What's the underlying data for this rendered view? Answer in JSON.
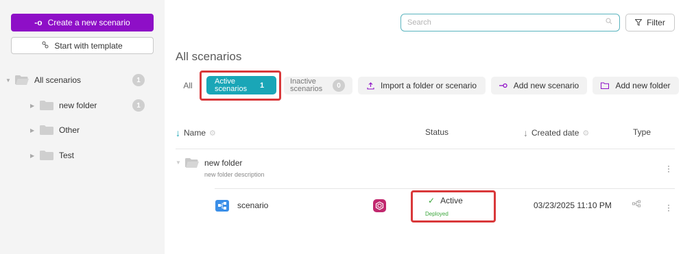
{
  "sidebar": {
    "create_label": "Create a new scenario",
    "template_label": "Start with template",
    "tree": [
      {
        "label": "All scenarios",
        "count": "1"
      },
      {
        "label": "new folder",
        "count": "1"
      },
      {
        "label": "Other"
      },
      {
        "label": "Test"
      }
    ]
  },
  "header": {
    "search_placeholder": "Search",
    "filter_label": "Filter",
    "title": "All scenarios"
  },
  "tabs": {
    "all": "All",
    "active_label": "Active scenarios",
    "active_count": "1",
    "inactive_label": "Inactive scenarios",
    "inactive_count": "0"
  },
  "actions": {
    "import": "Import a folder or scenario",
    "add_scenario": "Add new scenario",
    "add_folder": "Add new folder"
  },
  "table": {
    "columns": {
      "name": "Name",
      "status": "Status",
      "created": "Created date",
      "type": "Type"
    },
    "folder": {
      "name": "new folder",
      "description": "new folder description"
    },
    "scenario": {
      "name": "scenario",
      "status": "Active",
      "substatus": "Deployed",
      "created": "03/23/2025 11:10 PM"
    }
  },
  "colors": {
    "brand": "#8e0fc7",
    "accent": "#1aa6b7",
    "highlight": "#d9383a",
    "status_green": "#3aa53a"
  },
  "icons": {
    "create": "connector-icon",
    "template": "template-icon",
    "search": "search-icon",
    "filter": "filter-icon",
    "import": "upload-icon",
    "add_scenario": "connector-icon",
    "add_folder": "folder-icon",
    "sort": "arrow-down-icon",
    "settings": "gear-icon",
    "scenario": "flow-icon",
    "deploy": "hexagon-icon",
    "check": "check-icon",
    "type": "flow-icon",
    "more": "kebab-icon"
  }
}
